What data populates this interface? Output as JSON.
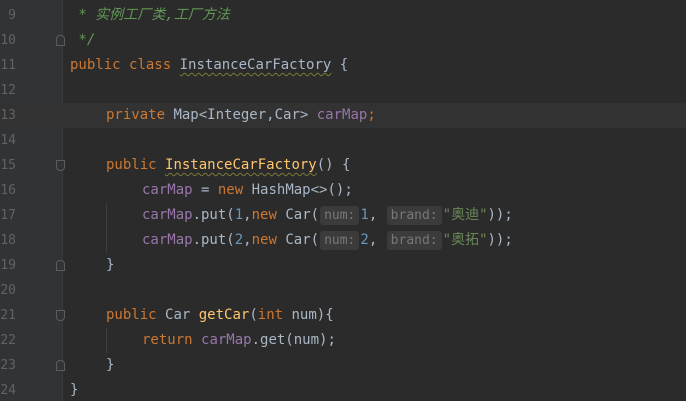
{
  "editor": {
    "lines": [
      {
        "n": "9",
        "comment": " * 实例工厂类,工厂方法"
      },
      {
        "n": "10",
        "comment": " */"
      },
      {
        "n": "11",
        "kw1": "public",
        "kw2": "class",
        "cls": "InstanceCarFactory",
        "tail": " {"
      },
      {
        "n": "12"
      },
      {
        "n": "13",
        "kw": "private",
        "type": "Map<Integer,Car>",
        "field": "carMap",
        "tail": ";"
      },
      {
        "n": "14"
      },
      {
        "n": "15",
        "kw": "public",
        "ctor": "InstanceCarFactory",
        "tail": "() {"
      },
      {
        "n": "16",
        "field": "carMap",
        "eq": " = ",
        "kw": "new",
        "rest": " HashMap<>();"
      },
      {
        "n": "17",
        "field": "carMap",
        "call": ".put(",
        "arg1": "1",
        "comma": ",",
        "kw": "new",
        "car": " Car(",
        "hint1": "num:",
        "val1": "1",
        "hint2": "brand:",
        "str": "\"奥迪\"",
        "tail": "));"
      },
      {
        "n": "18",
        "field": "carMap",
        "call": ".put(",
        "arg1": "2",
        "comma": ",",
        "kw": "new",
        "car": " Car(",
        "hint1": "num:",
        "val1": "2",
        "hint2": "brand:",
        "str": "\"奥拓\"",
        "tail": "));"
      },
      {
        "n": "19",
        "brace": "}"
      },
      {
        "n": "20"
      },
      {
        "n": "21",
        "kw": "public",
        "type": "Car",
        "method": "getCar",
        "paren": "(",
        "kw2": "int",
        "param": " num){"
      },
      {
        "n": "22",
        "kw": "return",
        "field": "carMap",
        "rest": ".get(num);"
      },
      {
        "n": "23",
        "brace": "}"
      },
      {
        "n": "24",
        "brace": "}"
      }
    ]
  },
  "colors": {
    "background": "#2b2b2b",
    "keyword": "#cc7832",
    "field": "#9876aa",
    "method": "#ffc66d",
    "number": "#6897bb",
    "string": "#6a8759",
    "comment": "#629755"
  }
}
